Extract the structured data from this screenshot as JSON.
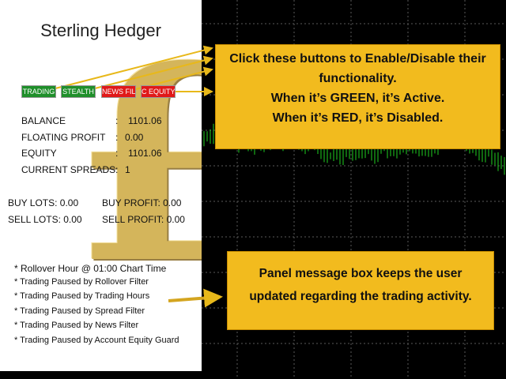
{
  "panel": {
    "title": "Sterling Hedger",
    "buttons": [
      {
        "label": "TRADING",
        "state": "green"
      },
      {
        "label": "STEALTH",
        "state": "green"
      },
      {
        "label": "NEWS FIL",
        "state": "red"
      },
      {
        "label": "C EQUITY",
        "state": "red"
      }
    ],
    "stats": [
      {
        "label": "BALANCE",
        "sep": ":",
        "value": "1101.06"
      },
      {
        "label": "FLOATING PROFIT",
        "sep": ":",
        "value": "0.00"
      },
      {
        "label": "EQUITY",
        "sep": ":",
        "value": "1101.06"
      },
      {
        "label": "CURRENT SPREADS",
        "sep": ":",
        "value": "1"
      }
    ],
    "buy_lots": "BUY LOTS: 0.00",
    "buy_profit": "BUY PROFIT: 0.00",
    "sell_lots": "SELL LOTS: 0.00",
    "sell_profit": "SELL PROFIT: 0.00",
    "messages": [
      "* Rollover Hour @ 01:00  Chart Time",
      "* Trading Paused by Rollover Filter",
      "* Trading Paused by Trading Hours",
      "* Trading Paused by Spread Filter",
      "* Trading Paused by News Filter",
      "* Trading Paused by Account Equity Guard"
    ]
  },
  "callouts": {
    "top": [
      "Click these buttons to Enable/Disable their",
      "functionality.",
      "When it’s GREEN, it’s Active.",
      "When it’s RED, it’s Disabled."
    ],
    "bottom": [
      "Panel message box keeps the user",
      "updated regarding the trading activity."
    ]
  },
  "colors": {
    "active": "#1f8f2a",
    "disabled": "#e01919",
    "callout": "#f2bb1e",
    "candles": "#1fd11f",
    "arrow": "#e8b81a"
  }
}
